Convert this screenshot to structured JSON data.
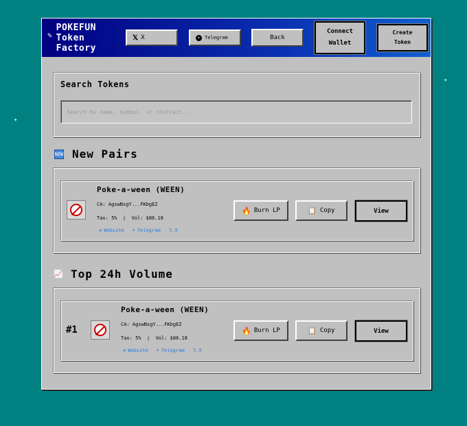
{
  "header": {
    "brand_line1": "POKEFUN",
    "brand_line2": "Token",
    "brand_line3": "Factory",
    "x_label": "X",
    "telegram_label": "Telegram",
    "back_label": "Back",
    "connect_line1": "Connect",
    "connect_line2": "Wallet",
    "create_line1": "Create",
    "create_line2": "Token"
  },
  "search": {
    "label": "Search Tokens",
    "placeholder": "Search by name, symbol, or contract..."
  },
  "new_pairs": {
    "title": "New Pairs",
    "icon_text": "NEW",
    "token": {
      "name": "Poke-a-ween (WEEN)",
      "ca": "CA: AgswBsgY...FKbgEZ",
      "tax_vol": "Tax: 5%  |  Vol: $86.18",
      "link_website": "Website",
      "link_telegram": "Telegram",
      "link_x": "X",
      "burn_label": "Burn LP",
      "copy_label": "Copy",
      "view_label": "View"
    }
  },
  "top_volume": {
    "title": "Top 24h Volume",
    "token": {
      "rank": "#1",
      "name": "Poke-a-ween (WEEN)",
      "ca": "CA: AgswBsgY...FKbgEZ",
      "tax_vol": "Tax: 5%  |  Vol: $86.18",
      "link_website": "Website",
      "link_telegram": "Telegram",
      "link_x": "X",
      "burn_label": "Burn LP",
      "copy_label": "Copy",
      "view_label": "View"
    }
  },
  "colors": {
    "desktop": "#008080",
    "titlebar": "#000080",
    "window": "#c0c0c0",
    "link": "#2a7ad8"
  }
}
